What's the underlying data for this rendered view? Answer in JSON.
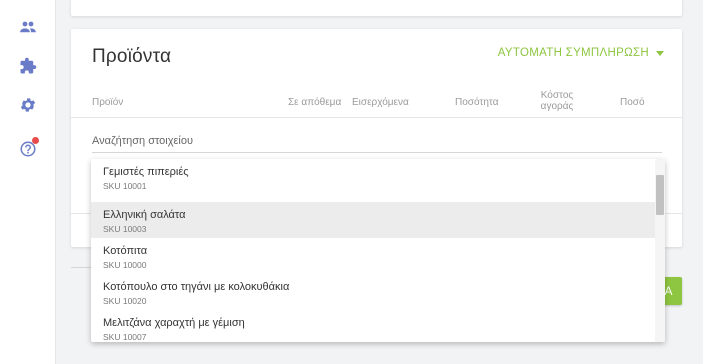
{
  "sidebar": {
    "icons": [
      "people-icon",
      "puzzle-icon",
      "gear-icon",
      "help-icon"
    ],
    "accent": "#6a7cc7",
    "notification_color": "#e94b4b"
  },
  "products": {
    "title": "Προϊόντα",
    "autofill_label": "ΑΥΤΟΜΑΤΗ ΣΥΜΠΛΗΡΩΣΗ",
    "columns": {
      "product": "Προϊόν",
      "in_stock": "Σε απόθεμα",
      "incoming": "Εισερχόμενα",
      "quantity": "Ποσότητα",
      "cost_line1": "Κόστος",
      "cost_line2": "αγοράς",
      "amount": "Ποσό"
    },
    "search_placeholder": "Αναζήτηση στοιχείου"
  },
  "action_button_label": "A",
  "dropdown": {
    "items": [
      {
        "name": "Γεμιστές πιπεριές",
        "sku": "SKU 10001"
      },
      {
        "name": "Ελληνική σαλάτα",
        "sku": "SKU 10003"
      },
      {
        "name": "Κοτόπιτα",
        "sku": "SKU 10000"
      },
      {
        "name": "Κοτόπουλο στο τηγάνι με κολοκυθάκια",
        "sku": "SKU 10020"
      },
      {
        "name": "Μελιτζάνα χαραχτή με γέμιση",
        "sku": "SKU 10007"
      }
    ],
    "highlighted_index": 1
  },
  "colors": {
    "accent_green": "#8ec641",
    "background": "#f2f3f5"
  }
}
